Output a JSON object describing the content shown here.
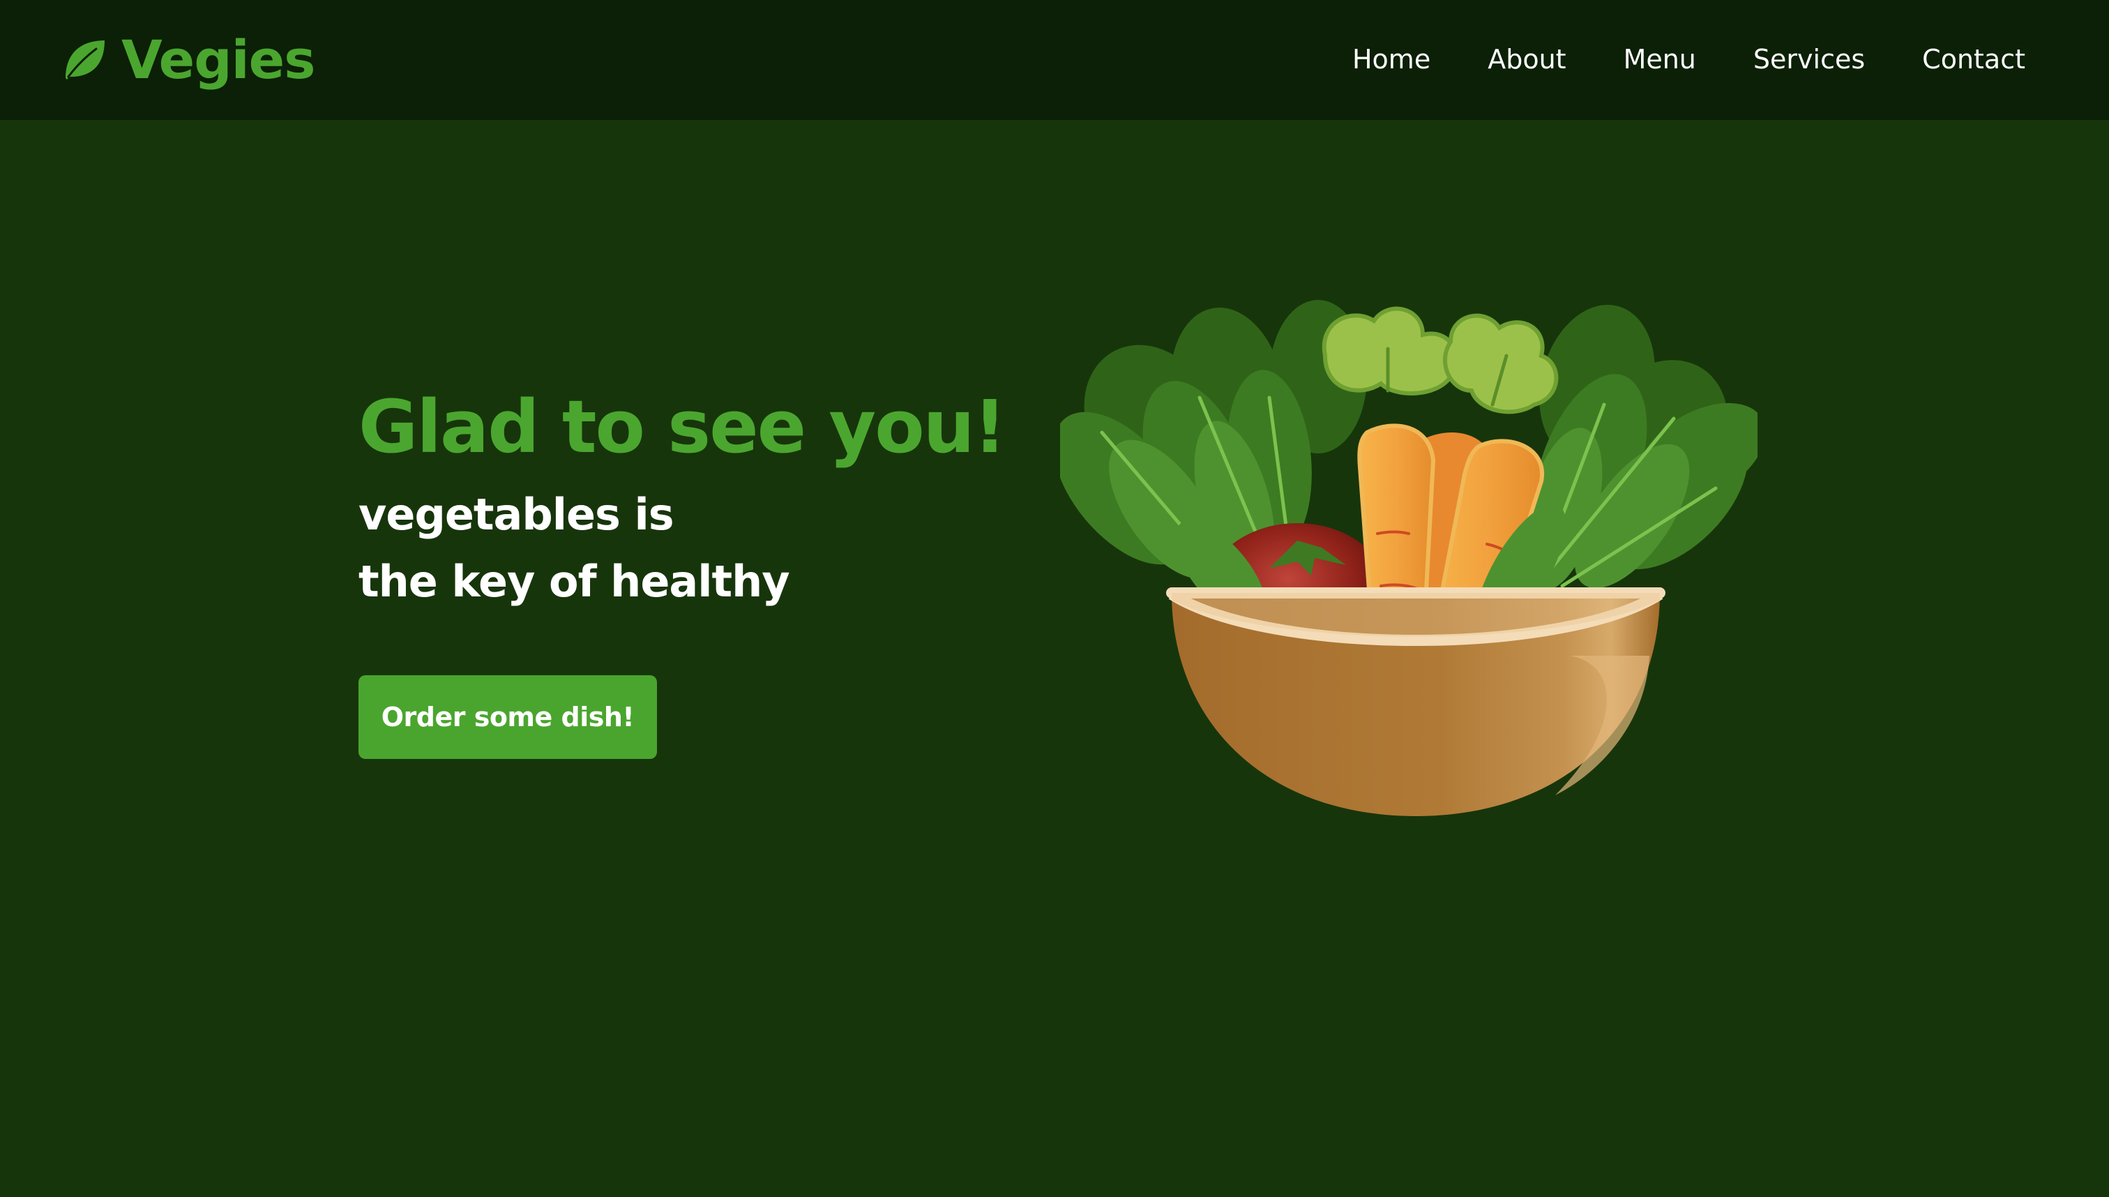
{
  "brand": {
    "name": "Vegies",
    "icon": "leaf-icon",
    "color": "#4ba62f"
  },
  "nav": {
    "items": [
      {
        "label": "Home"
      },
      {
        "label": "About"
      },
      {
        "label": "Menu"
      },
      {
        "label": "Services"
      },
      {
        "label": "Contact"
      }
    ]
  },
  "hero": {
    "title": "Glad to see you!",
    "subtitle_line1": "vegetables is",
    "subtitle_line2": "the key of healthy",
    "cta_label": "Order some dish!",
    "image": "vegetable-bowl-illustration"
  },
  "colors": {
    "background": "#17350b",
    "header": "#0b2006",
    "accent": "#4aa52e",
    "text": "#ffffff"
  }
}
